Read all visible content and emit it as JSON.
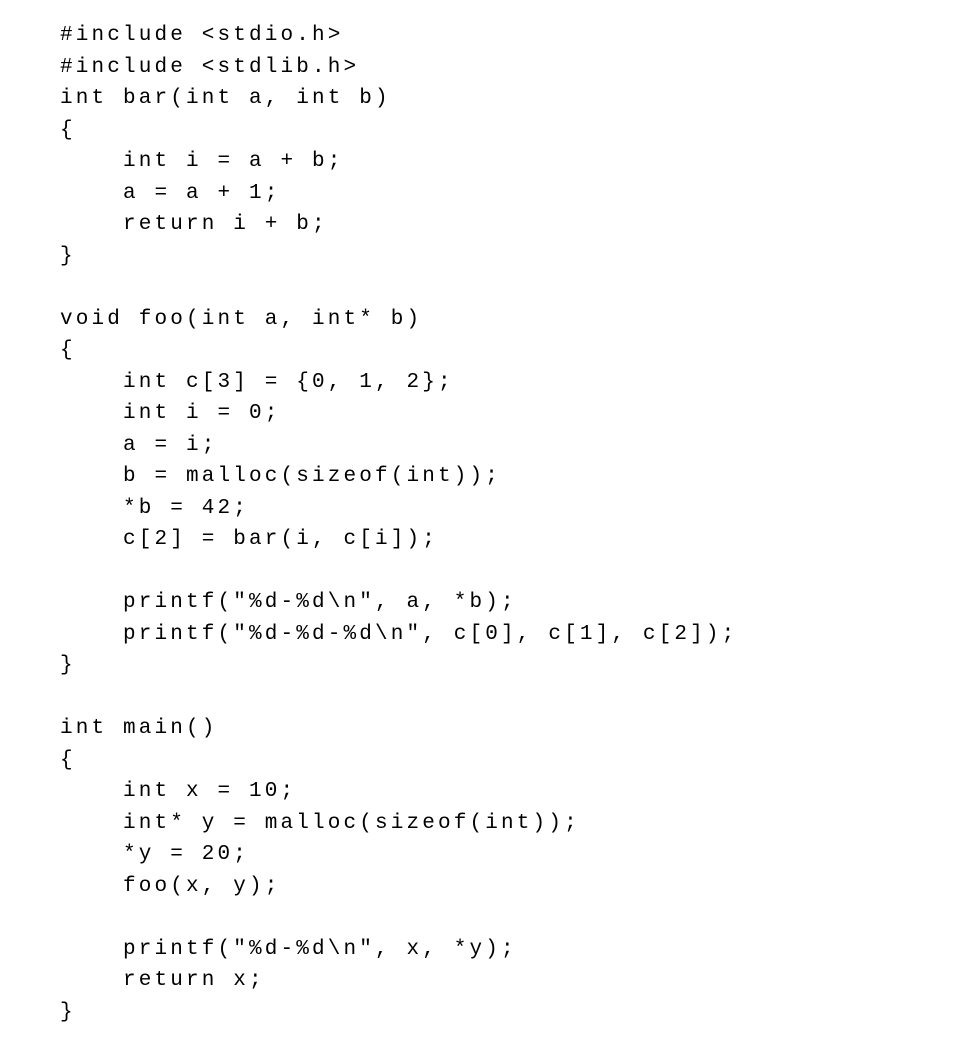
{
  "code": {
    "lines": [
      "#include <stdio.h>",
      "#include <stdlib.h>",
      "int bar(int a, int b)",
      "{",
      "    int i = a + b;",
      "    a = a + 1;",
      "    return i + b;",
      "}",
      "",
      "void foo(int a, int* b)",
      "{",
      "    int c[3] = {0, 1, 2};",
      "    int i = 0;",
      "    a = i;",
      "    b = malloc(sizeof(int));",
      "    *b = 42;",
      "    c[2] = bar(i, c[i]);",
      "",
      "    printf(\"%d-%d\\n\", a, *b);",
      "    printf(\"%d-%d-%d\\n\", c[0], c[1], c[2]);",
      "}",
      "",
      "int main()",
      "{",
      "    int x = 10;",
      "    int* y = malloc(sizeof(int));",
      "    *y = 20;",
      "    foo(x, y);",
      "",
      "    printf(\"%d-%d\\n\", x, *y);",
      "    return x;",
      "}"
    ]
  }
}
